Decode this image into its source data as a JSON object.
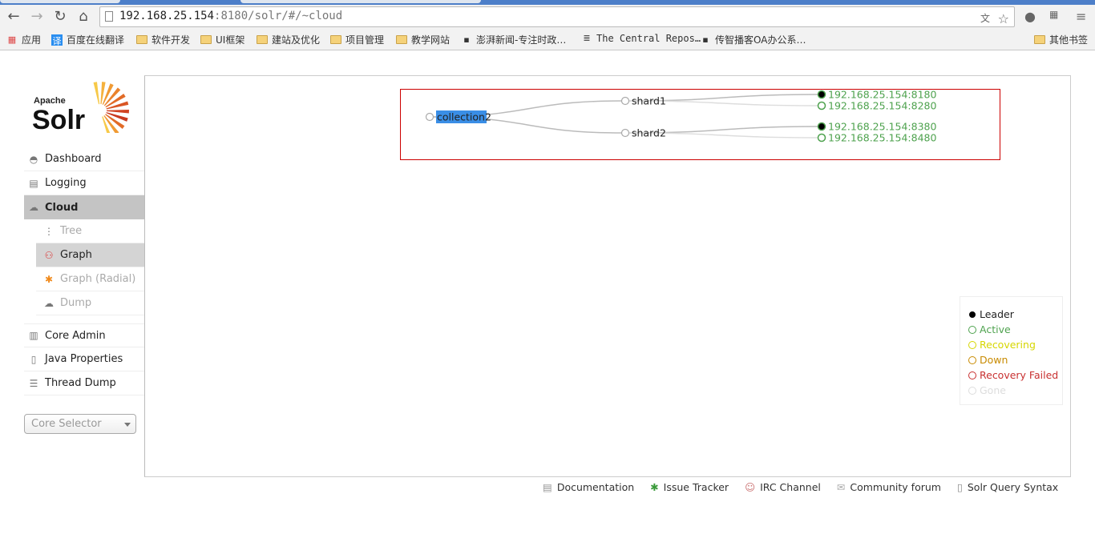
{
  "browser": {
    "url_host": "192.168.25.154",
    "url_rest": ":8180/solr/#/~cloud",
    "bookmarks": [
      {
        "label": "应用",
        "icon": "apps-grid-icon"
      },
      {
        "label": "百度在线翻译",
        "icon": "translate-icon"
      },
      {
        "label": "软件开发",
        "icon": "folder-icon"
      },
      {
        "label": "UI框架",
        "icon": "folder-icon"
      },
      {
        "label": "建站及优化",
        "icon": "folder-icon"
      },
      {
        "label": "项目管理",
        "icon": "folder-icon"
      },
      {
        "label": "教学网站",
        "icon": "folder-icon"
      },
      {
        "label": "澎湃新闻-专注时政…",
        "icon": "site-icon"
      },
      {
        "label": "The Central Repos…",
        "icon": "list-icon"
      },
      {
        "label": "传智播客OA办公系…",
        "icon": "site-icon"
      }
    ],
    "other_bookmarks": "其他书签"
  },
  "logo": {
    "small": "Apache",
    "big": "Solr"
  },
  "sidebar": {
    "items": [
      {
        "label": "Dashboard"
      },
      {
        "label": "Logging"
      },
      {
        "label": "Cloud"
      },
      {
        "label": "Tree"
      },
      {
        "label": "Graph"
      },
      {
        "label": "Graph (Radial)"
      },
      {
        "label": "Dump"
      },
      {
        "label": "Core Admin"
      },
      {
        "label": "Java Properties"
      },
      {
        "label": "Thread Dump"
      }
    ],
    "core_selector": "Core Selector"
  },
  "graph": {
    "collection": "collection2",
    "shards": [
      {
        "name": "shard1",
        "replicas": [
          {
            "name": "192.168.25.154:8180",
            "leader": true
          },
          {
            "name": "192.168.25.154:8280",
            "leader": false
          }
        ]
      },
      {
        "name": "shard2",
        "replicas": [
          {
            "name": "192.168.25.154:8380",
            "leader": true
          },
          {
            "name": "192.168.25.154:8480",
            "leader": false
          }
        ]
      }
    ]
  },
  "legend": [
    {
      "label": "Leader",
      "color": "#000000",
      "filled": true
    },
    {
      "label": "Active",
      "color": "#4ea24e"
    },
    {
      "label": "Recovering",
      "color": "#d6d600"
    },
    {
      "label": "Down",
      "color": "#c88a00"
    },
    {
      "label": "Recovery Failed",
      "color": "#c83030"
    },
    {
      "label": "Gone",
      "color": "#dddddd"
    }
  ],
  "footer": [
    {
      "label": "Documentation"
    },
    {
      "label": "Issue Tracker"
    },
    {
      "label": "IRC Channel"
    },
    {
      "label": "Community forum"
    },
    {
      "label": "Solr Query Syntax"
    }
  ]
}
